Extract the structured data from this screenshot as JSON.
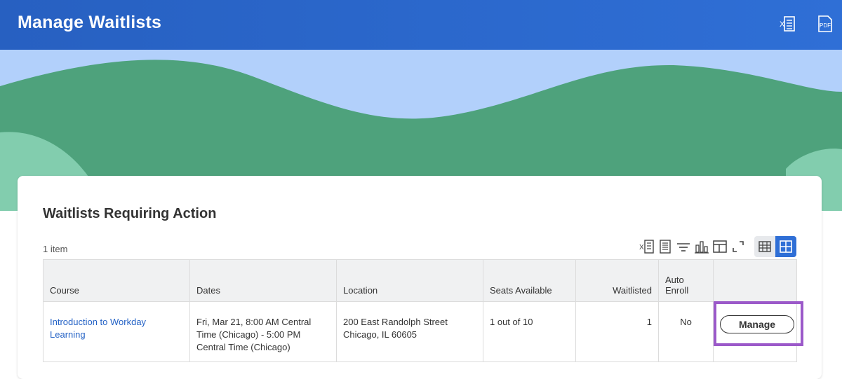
{
  "header": {
    "title": "Manage Waitlists",
    "icons": [
      "excel-export-icon",
      "pdf-export-icon"
    ],
    "color": "#2f6fd6"
  },
  "card": {
    "title": "Waitlists Requiring Action",
    "item_count": "1 item"
  },
  "toolbar": {
    "icons": [
      "excel-export-icon",
      "print-icon",
      "filter-icon",
      "chart-icon",
      "column-layout-icon",
      "fullscreen-icon"
    ],
    "view_toggle": {
      "options": [
        "table-view-icon",
        "grid-view-icon"
      ],
      "selected": "grid-view-icon"
    }
  },
  "table": {
    "columns": {
      "course": "Course",
      "dates": "Dates",
      "location": "Location",
      "seats": "Seats Available",
      "waitlisted": "Waitlisted",
      "auto_enroll": "Auto Enroll"
    },
    "rows": [
      {
        "course": "Introduction to Workday Learning",
        "dates": "Fri, Mar 21, 8:00 AM Central Time (Chicago)  -  5:00 PM Central Time (Chicago)",
        "location_line1": "200 East Randolph Street",
        "location_line2": "Chicago, IL 60605",
        "seats": "1 out of 10",
        "waitlisted": "1",
        "auto_enroll": "No",
        "action_label": "Manage"
      }
    ]
  },
  "colors": {
    "link": "#2563c6",
    "highlight": "#9b59c9",
    "banner_sky": "#b2d0fb",
    "banner_hill": "#4ea27c",
    "banner_hill_light": "#82cdae"
  }
}
